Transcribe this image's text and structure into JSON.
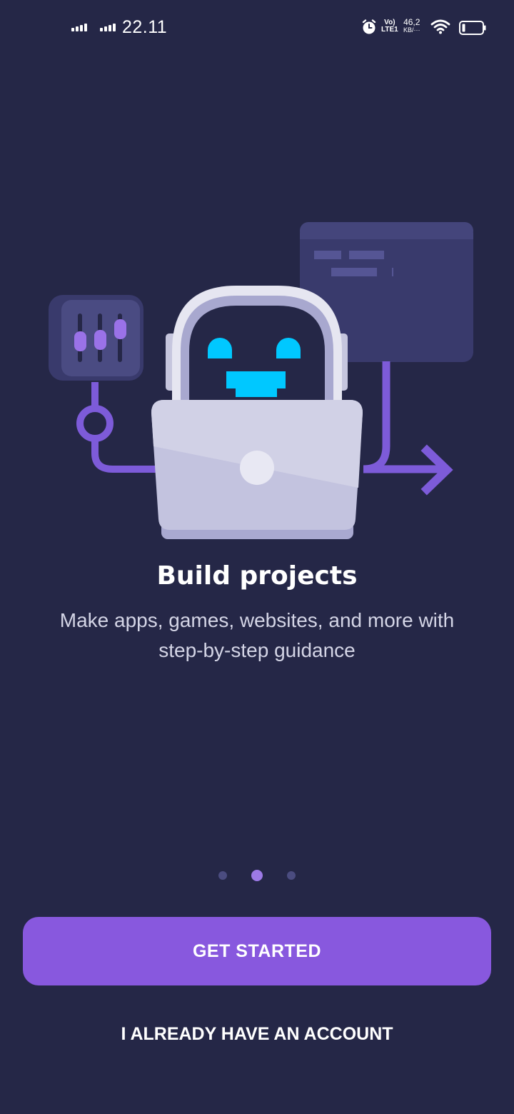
{
  "status_bar": {
    "time": "22.11",
    "network_type_top": "Vo)",
    "network_type_bottom": "LTE1",
    "speed_value": "46,2",
    "speed_unit": "KB/···",
    "icons": [
      "signal-icon",
      "signal-icon",
      "alarm-icon",
      "wifi-icon",
      "battery-icon"
    ]
  },
  "onboarding": {
    "title": "Build projects",
    "subtitle": "Make apps, games, websites, and more with step-by-step guidance",
    "illustration": "robot-with-laptop-illustration",
    "page_indicator": {
      "current": 2,
      "total": 3
    }
  },
  "actions": {
    "get_started_label": "GET STARTED",
    "login_label": "I ALREADY HAVE AN ACCOUNT"
  },
  "colors": {
    "background": "#252747",
    "accent": "#8858de",
    "robot_face": "#00c8ff"
  }
}
